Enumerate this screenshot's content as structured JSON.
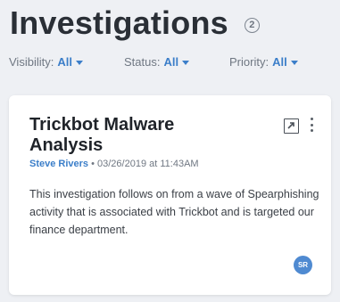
{
  "header": {
    "title": "Investigations",
    "count": "2"
  },
  "filters": [
    {
      "label": "Visibility:",
      "value": "All"
    },
    {
      "label": "Status:",
      "value": "All"
    },
    {
      "label": "Priority:",
      "value": "All"
    }
  ],
  "card": {
    "title": "Trickbot Malware Analysis",
    "author": "Steve Rivers",
    "separator": " • ",
    "timestamp": "03/26/2019 at 11:43AM",
    "description": "This investigation follows on from a wave of Spearphishing activity that is associated with Trickbot and is targeted our finance department.",
    "assignee_initials": "SR",
    "icons": {
      "open": "open-external-icon",
      "more": "more-vertical-icon"
    }
  },
  "colors": {
    "background": "#eef0f4",
    "accent": "#3b7ec9",
    "avatar": "#4f8ad1"
  }
}
